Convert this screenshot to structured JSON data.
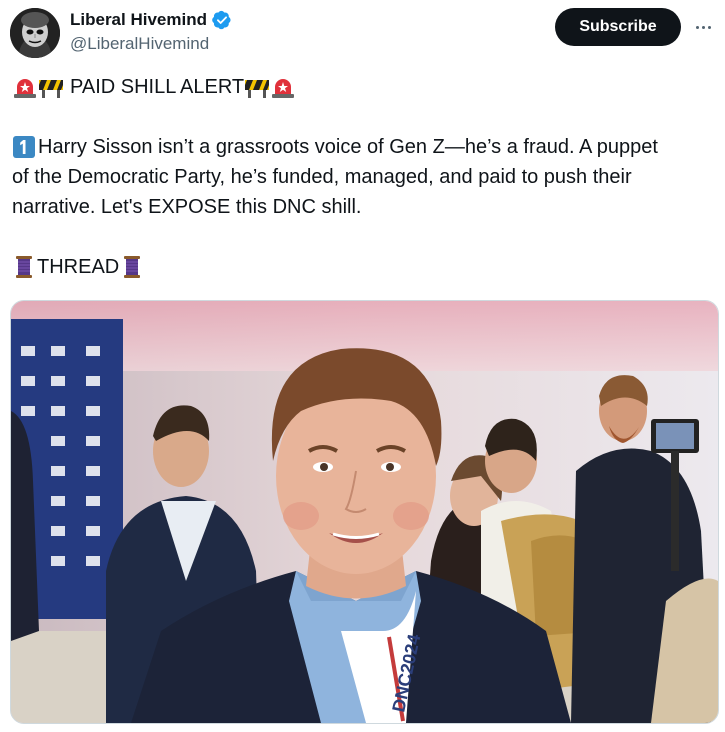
{
  "author": {
    "display_name": "Liberal Hivemind",
    "handle": "@LiberalHivemind",
    "verified": true
  },
  "actions": {
    "subscribe_label": "Subscribe",
    "more_icon": "more-dots-icon"
  },
  "tweet": {
    "headline": "PAID SHILL ALERT",
    "body_line1": "Harry Sisson isn’t a grassroots voice of Gen Z—he’s a fraud. A puppet",
    "body_line2": "of the Democratic Party, he’s funded, managed, and paid to push their",
    "body_line3": "narrative. Let's EXPOSE this DNC shill.",
    "thread_label": "THREAD",
    "emojis": [
      "rotating-light-icon",
      "construction-barrier-icon",
      "keycap-one-icon",
      "spool-of-thread-icon"
    ]
  },
  "media": {
    "lanyard_text": "DNC2024"
  },
  "colors": {
    "subscribe_bg": "#0f1419",
    "verified_blue": "#1d9bf0",
    "handle_gray": "#536471",
    "siren_red": "#e0313b",
    "keycap_blue": "#3b88c3",
    "spool_purple": "#553788"
  }
}
